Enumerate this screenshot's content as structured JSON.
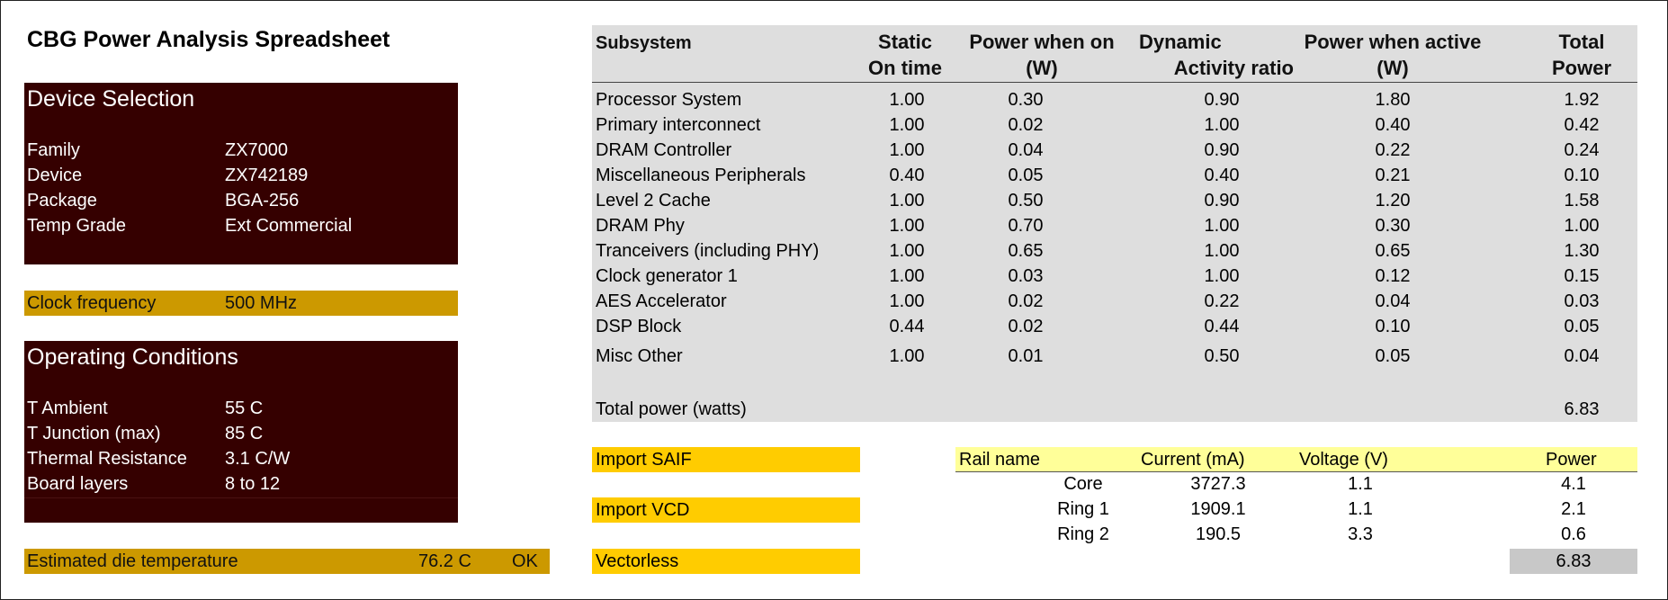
{
  "title": "CBG Power Analysis Spreadsheet",
  "device_selection": {
    "heading": "Device Selection",
    "rows": [
      {
        "label": "Family",
        "value": "ZX7000"
      },
      {
        "label": "Device",
        "value": "ZX742189"
      },
      {
        "label": "Package",
        "value": "BGA-256"
      },
      {
        "label": "Temp Grade",
        "value": "Ext Commercial"
      }
    ]
  },
  "clock": {
    "label": "Clock frequency",
    "value": "500 MHz"
  },
  "operating_conditions": {
    "heading": "Operating Conditions",
    "rows": [
      {
        "label": "T Ambient",
        "value": "55 C"
      },
      {
        "label": "T Junction (max)",
        "value": "85 C"
      },
      {
        "label": "Thermal Resistance",
        "value": "3.1 C/W"
      },
      {
        "label": "Board layers",
        "value": "8 to 12"
      }
    ]
  },
  "estimate": {
    "label": "Estimated die temperature",
    "value": "76.2 C",
    "status": "OK"
  },
  "subsystem_table": {
    "headers": {
      "subsystem": "Subsystem",
      "static_line1": "Static",
      "static_line2": "On time",
      "pwr_on_line1": "Power when on",
      "pwr_on_line2": "(W)",
      "dynamic_line1": "Dynamic",
      "dynamic_line2": "Activity ratio",
      "pwr_active_line1": "Power when active",
      "pwr_active_line2": "(W)",
      "total_line1": "Total",
      "total_line2": "Power"
    },
    "rows": [
      {
        "name": "Processor System",
        "static": "1.00",
        "pwr_on": "0.30",
        "activity": "0.90",
        "pwr_active": "1.80",
        "total": "1.92"
      },
      {
        "name": "Primary interconnect",
        "static": "1.00",
        "pwr_on": "0.02",
        "activity": "1.00",
        "pwr_active": "0.40",
        "total": "0.42"
      },
      {
        "name": "DRAM Controller",
        "static": "1.00",
        "pwr_on": "0.04",
        "activity": "0.90",
        "pwr_active": "0.22",
        "total": "0.24"
      },
      {
        "name": "Miscellaneous Peripherals",
        "static": "0.40",
        "pwr_on": "0.05",
        "activity": "0.40",
        "pwr_active": "0.21",
        "total": "0.10"
      },
      {
        "name": "Level 2 Cache",
        "static": "1.00",
        "pwr_on": "0.50",
        "activity": "0.90",
        "pwr_active": "1.20",
        "total": "1.58"
      },
      {
        "name": "DRAM Phy",
        "static": "1.00",
        "pwr_on": "0.70",
        "activity": "1.00",
        "pwr_active": "0.30",
        "total": "1.00"
      },
      {
        "name": "Tranceivers (including PHY)",
        "static": "1.00",
        "pwr_on": "0.65",
        "activity": "1.00",
        "pwr_active": "0.65",
        "total": "1.30"
      },
      {
        "name": "Clock generator 1",
        "static": "1.00",
        "pwr_on": "0.03",
        "activity": "1.00",
        "pwr_active": "0.12",
        "total": "0.15"
      },
      {
        "name": "AES Accelerator",
        "static": "1.00",
        "pwr_on": "0.02",
        "activity": "0.22",
        "pwr_active": "0.04",
        "total": "0.03"
      },
      {
        "name": "DSP Block",
        "static": "0.44",
        "pwr_on": "0.02",
        "activity": "0.44",
        "pwr_active": "0.10",
        "total": "0.05"
      },
      {
        "name": "Misc Other",
        "static": "1.00",
        "pwr_on": "0.01",
        "activity": "0.50",
        "pwr_active": "0.05",
        "total": "0.04"
      }
    ],
    "total_label": "Total power (watts)",
    "total_value": "6.83"
  },
  "buttons": {
    "import_saif": "Import SAIF",
    "import_vcd": "Import VCD",
    "vectorless": "Vectorless"
  },
  "rails": {
    "headers": {
      "name": "Rail name",
      "current": "Current (mA)",
      "voltage": "Voltage (V)",
      "power": "Power"
    },
    "rows": [
      {
        "name": "Core",
        "current": "3727.3",
        "voltage": "1.1",
        "power": "4.1"
      },
      {
        "name": "Ring 1",
        "current": "1909.1",
        "voltage": "1.1",
        "power": "2.1"
      },
      {
        "name": "Ring 2",
        "current": "190.5",
        "voltage": "3.3",
        "power": "0.6"
      }
    ],
    "total": "6.83"
  }
}
